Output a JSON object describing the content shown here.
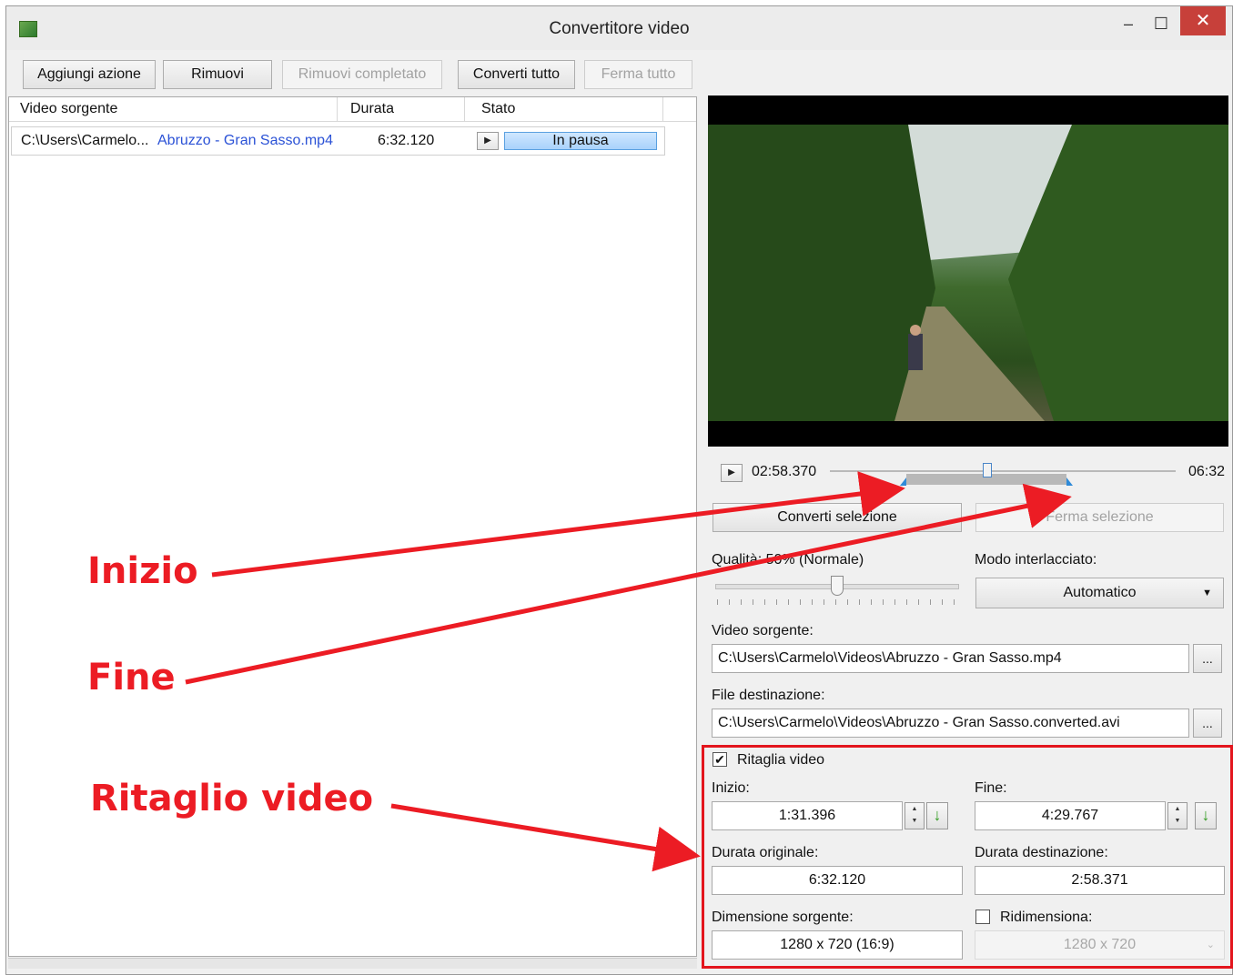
{
  "window": {
    "title": "Convertitore video"
  },
  "toolbar": {
    "add_action": "Aggiungi azione",
    "remove": "Rimuovi",
    "remove_completed": "Rimuovi completato",
    "convert_all": "Converti tutto",
    "stop_all": "Ferma tutto"
  },
  "list": {
    "columns": [
      "Video sorgente",
      "Durata",
      "Stato"
    ],
    "rows": [
      {
        "path_prefix": "C:\\Users\\Carmelo...",
        "file_name": "Abruzzo - Gran Sasso.mp4",
        "duration": "6:32.120",
        "status": "In pausa"
      }
    ]
  },
  "player": {
    "current_time": "02:58.370",
    "total_time": "06:32",
    "position_fraction": 0.455,
    "selection_start_fraction": 0.22,
    "selection_end_fraction": 0.685
  },
  "actions": {
    "convert_selection": "Converti selezione",
    "stop_selection": "Ferma selezione"
  },
  "quality": {
    "label": "Qualità: 50% (Normale)",
    "value_percent": 50
  },
  "interlace": {
    "label": "Modo interlacciato:",
    "value": "Automatico"
  },
  "source": {
    "label": "Video sorgente:",
    "value": "C:\\Users\\Carmelo\\Videos\\Abruzzo - Gran Sasso.mp4",
    "browse": "..."
  },
  "destination": {
    "label": "File destinazione:",
    "value": "C:\\Users\\Carmelo\\Videos\\Abruzzo - Gran Sasso.converted.avi",
    "browse": "..."
  },
  "trim": {
    "checkbox_label": "Ritaglia video",
    "checked": true,
    "start_label": "Inizio:",
    "start_value": "1:31.396",
    "end_label": "Fine:",
    "end_value": "4:29.767",
    "orig_duration_label": "Durata originale:",
    "orig_duration_value": "6:32.120",
    "dest_duration_label": "Durata destinazione:",
    "dest_duration_value": "2:58.371",
    "source_size_label": "Dimensione sorgente:",
    "source_size_value": "1280 x 720 (16:9)",
    "resize_label": "Ridimensiona:",
    "resize_checked": false,
    "resize_value": "1280 x 720"
  },
  "annotations": {
    "start": "Inizio",
    "end": "Fine",
    "trim": "Ritaglio video"
  },
  "colors": {
    "annotation": "#ec1c24",
    "close_button": "#c7403a",
    "link_text": "#2b52d6",
    "progress_fill": "#a9d2fb"
  }
}
